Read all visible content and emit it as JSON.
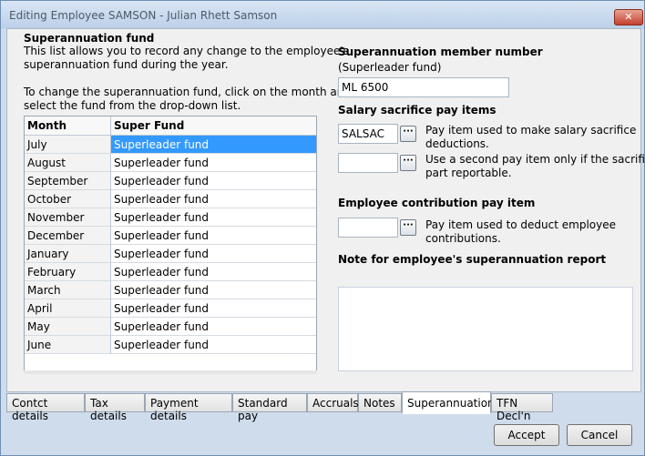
{
  "window": {
    "title": "Editing Employee SAMSON - Julian Rhett Samson",
    "close_glyph": "✕"
  },
  "left": {
    "heading": "Superannuation fund",
    "desc_line1": "This list allows you to record any change to the employee's",
    "desc_line2": "superannuation fund during the year.",
    "instr_line1": "To change the superannuation fund, click on the month and",
    "instr_line2": "select the fund from the drop-down list.",
    "table": {
      "headers": [
        "Month",
        "Super Fund"
      ],
      "rows": [
        {
          "month": "July",
          "fund": "Superleader fund",
          "selected": true
        },
        {
          "month": "August",
          "fund": "Superleader fund"
        },
        {
          "month": "September",
          "fund": "Superleader fund"
        },
        {
          "month": "October",
          "fund": "Superleader fund"
        },
        {
          "month": "November",
          "fund": "Superleader fund"
        },
        {
          "month": "December",
          "fund": "Superleader fund"
        },
        {
          "month": "January",
          "fund": "Superleader fund"
        },
        {
          "month": "February",
          "fund": "Superleader fund"
        },
        {
          "month": "March",
          "fund": "Superleader fund"
        },
        {
          "month": "April",
          "fund": "Superleader fund"
        },
        {
          "month": "May",
          "fund": "Superleader fund"
        },
        {
          "month": "June",
          "fund": "Superleader fund"
        }
      ]
    }
  },
  "right": {
    "member_label": "Superannuation member number",
    "member_sub": "(Superleader fund)",
    "member_value": "ML 6500",
    "salary_heading": "Salary sacrifice pay items",
    "salary_item1_value": "SALSAC",
    "salary_item1_desc1": "Pay item used to make salary sacrifice",
    "salary_item1_desc2": "deductions.",
    "salary_item2_value": "",
    "salary_item2_desc1": "Use a second pay item only if the sacrifice is",
    "salary_item2_desc2": "part reportable.",
    "employee_heading": "Employee contribution pay item",
    "employee_value": "",
    "employee_desc1": "Pay item used to deduct employee",
    "employee_desc2": "contributions.",
    "note_heading": "Note for employee's superannuation report",
    "note_value": "",
    "ellipsis": "···"
  },
  "tabs": [
    "Contct details",
    "Tax details",
    "Payment details",
    "Standard pay",
    "Accruals",
    "Notes",
    "Superannuation",
    "TFN Decl'n"
  ],
  "active_tab": "Superannuation",
  "buttons": {
    "accept": "Accept",
    "cancel": "Cancel"
  }
}
